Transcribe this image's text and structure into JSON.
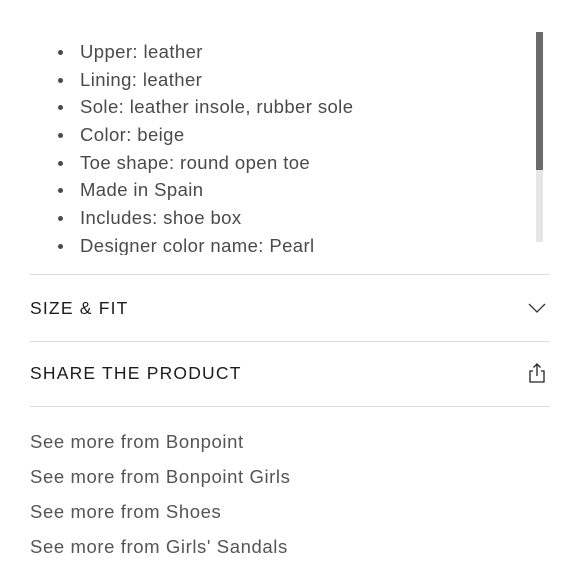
{
  "details": {
    "items": [
      "Upper: leather",
      "Lining: leather",
      "Sole: leather insole, rubber sole",
      "Color: beige",
      "Toe shape: round open toe",
      "Made in Spain",
      "Includes: shoe box",
      "Designer color name: Pearl"
    ]
  },
  "size_fit": {
    "title": "SIZE & FIT",
    "icon": "chevron-down-icon"
  },
  "share": {
    "title": "SHARE THE PRODUCT",
    "icon": "share-icon"
  },
  "see_more": {
    "links": [
      "See more from Bonpoint",
      "See more from Bonpoint Girls",
      "See more from Shoes",
      "See more from Girls' Sandals"
    ]
  }
}
